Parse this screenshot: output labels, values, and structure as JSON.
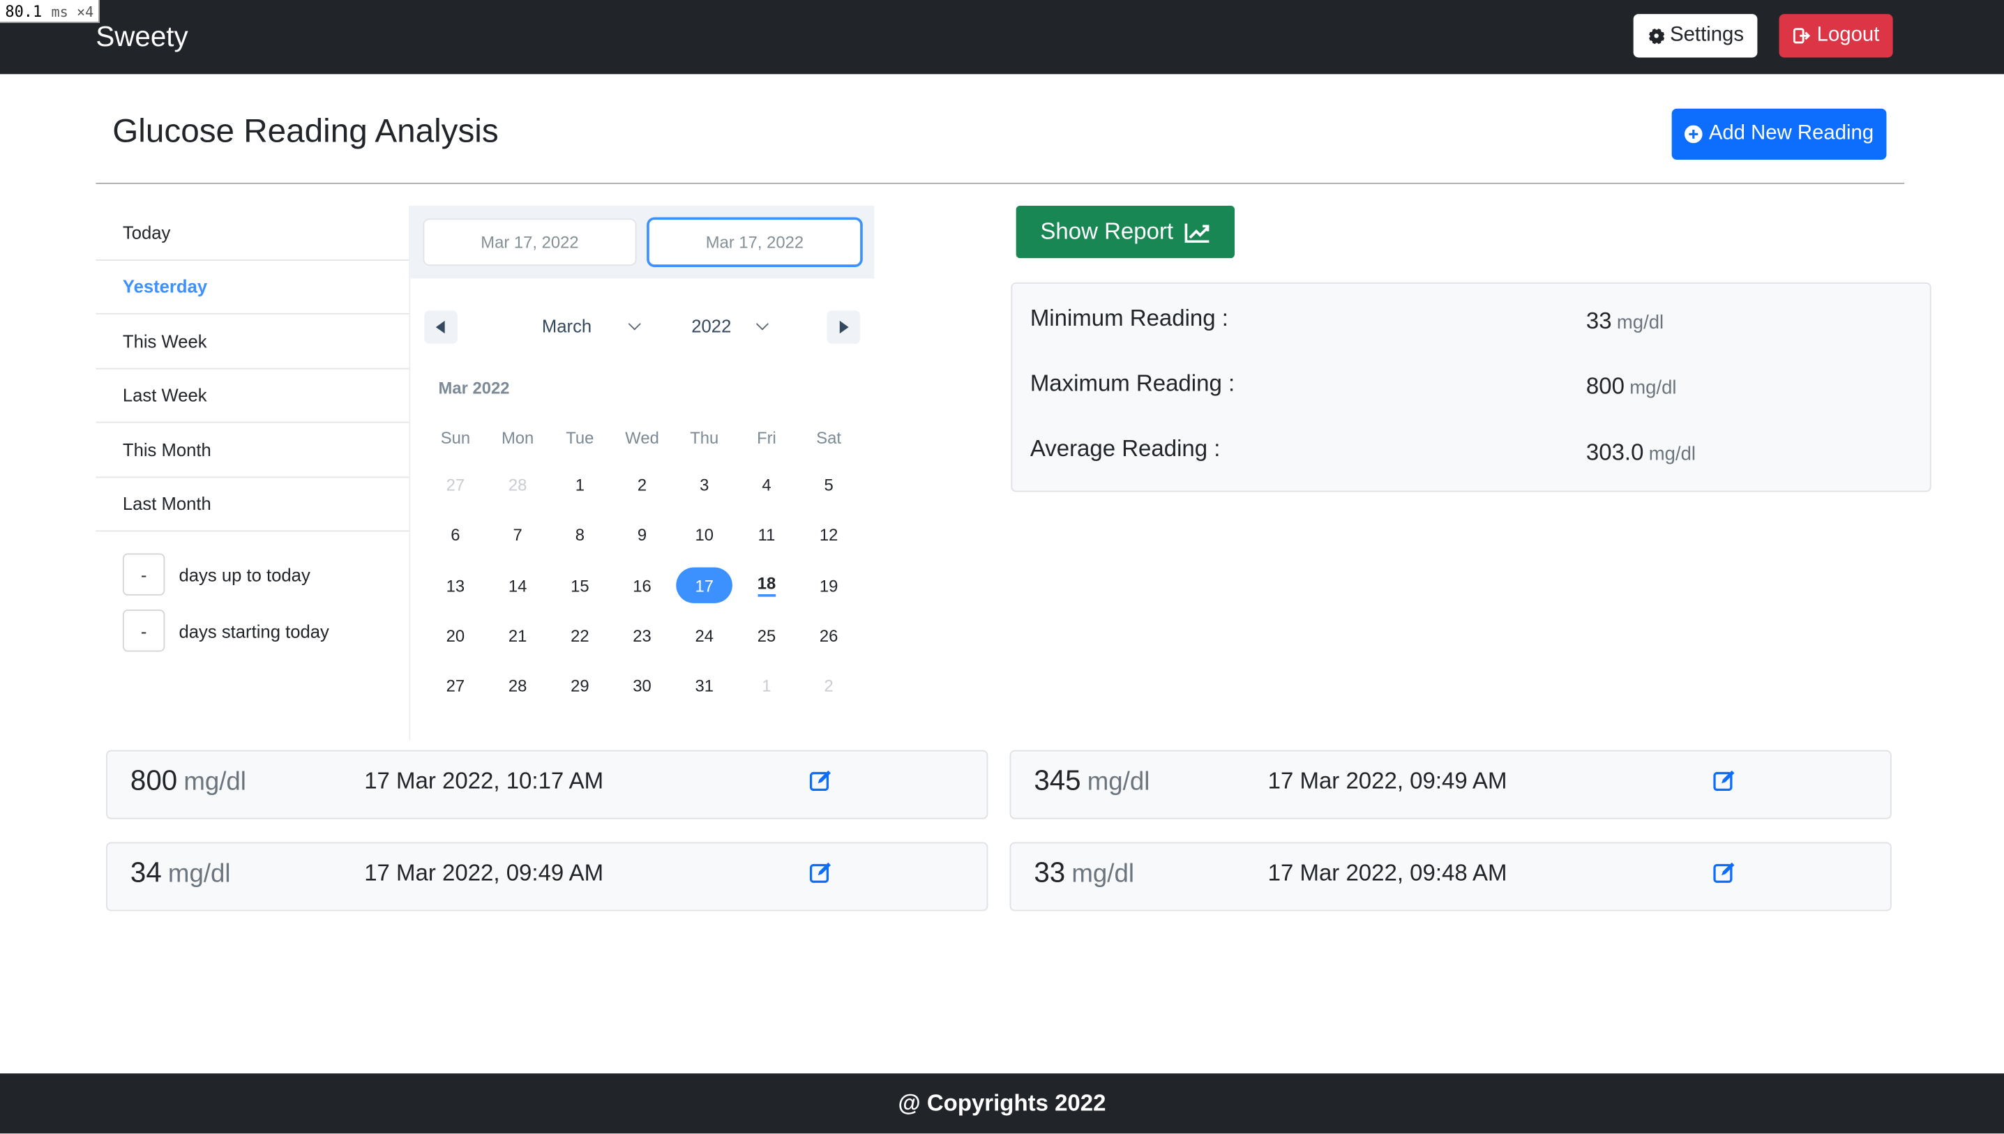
{
  "perf": {
    "value": "80.1",
    "unit": "ms ×4"
  },
  "navbar": {
    "brand": "Sweety",
    "settings_label": "Settings",
    "logout_label": "Logout"
  },
  "header": {
    "title": "Glucose Reading Analysis",
    "add_label": "Add New Reading"
  },
  "ranges": {
    "items": [
      {
        "label": "Today",
        "active": false
      },
      {
        "label": "Yesterday",
        "active": true
      },
      {
        "label": "This Week",
        "active": false
      },
      {
        "label": "Last Week",
        "active": false
      },
      {
        "label": "This Month",
        "active": false
      },
      {
        "label": "Last Month",
        "active": false
      }
    ],
    "days_up_value": "-",
    "days_up_label": "days up to today",
    "days_start_value": "-",
    "days_start_label": "days starting today"
  },
  "calendar": {
    "start_date": "Mar 17, 2022",
    "end_date": "Mar 17, 2022",
    "month": "March",
    "year": "2022",
    "month_label": "Mar 2022",
    "weekdays": [
      "Sun",
      "Mon",
      "Tue",
      "Wed",
      "Thu",
      "Fri",
      "Sat"
    ],
    "days": [
      {
        "d": "27",
        "muted": true
      },
      {
        "d": "28",
        "muted": true
      },
      {
        "d": "1"
      },
      {
        "d": "2"
      },
      {
        "d": "3"
      },
      {
        "d": "4"
      },
      {
        "d": "5"
      },
      {
        "d": "6"
      },
      {
        "d": "7"
      },
      {
        "d": "8"
      },
      {
        "d": "9"
      },
      {
        "d": "10"
      },
      {
        "d": "11"
      },
      {
        "d": "12"
      },
      {
        "d": "13"
      },
      {
        "d": "14"
      },
      {
        "d": "15"
      },
      {
        "d": "16"
      },
      {
        "d": "17",
        "selected": true
      },
      {
        "d": "18",
        "today": true
      },
      {
        "d": "19"
      },
      {
        "d": "20"
      },
      {
        "d": "21"
      },
      {
        "d": "22"
      },
      {
        "d": "23"
      },
      {
        "d": "24"
      },
      {
        "d": "25"
      },
      {
        "d": "26"
      },
      {
        "d": "27"
      },
      {
        "d": "28"
      },
      {
        "d": "29"
      },
      {
        "d": "30"
      },
      {
        "d": "31"
      },
      {
        "d": "1",
        "muted": true
      },
      {
        "d": "2",
        "muted": true
      }
    ]
  },
  "report": {
    "button_label": "Show Report",
    "min_label": "Minimum Reading :",
    "min_value": "33",
    "max_label": "Maximum Reading :",
    "max_value": "800",
    "avg_label": "Average Reading :",
    "avg_value": "303.0",
    "unit": "mg/dl"
  },
  "readings": [
    {
      "value": "800",
      "unit": "mg/dl",
      "time": "17 Mar 2022, 10:17 AM"
    },
    {
      "value": "345",
      "unit": "mg/dl",
      "time": "17 Mar 2022, 09:49 AM"
    },
    {
      "value": "34",
      "unit": "mg/dl",
      "time": "17 Mar 2022, 09:49 AM"
    },
    {
      "value": "33",
      "unit": "mg/dl",
      "time": "17 Mar 2022, 09:48 AM"
    }
  ],
  "footer": {
    "text": "@ Copyrights 2022"
  },
  "colors": {
    "navbar": "#212529",
    "primary": "#0d6efd",
    "danger": "#dc3545",
    "success": "#198754",
    "accent": "#3d91ff"
  }
}
